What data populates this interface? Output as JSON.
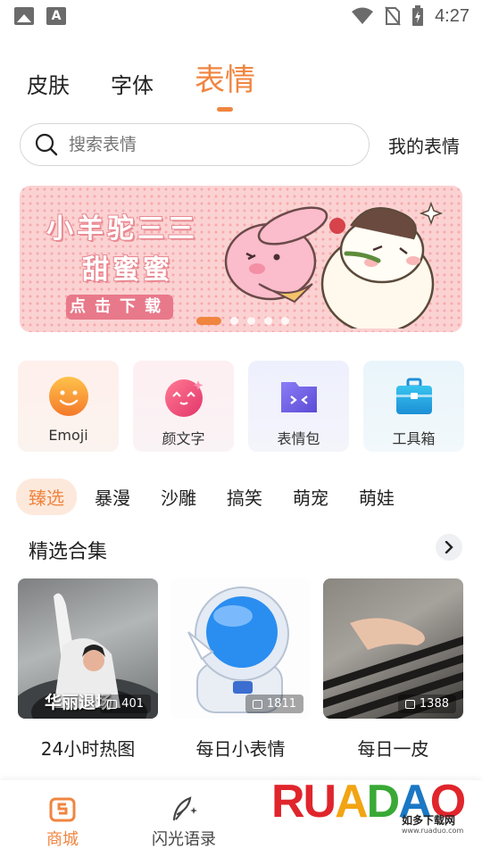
{
  "status_bar": {
    "time": "4:27"
  },
  "top_tabs": [
    {
      "label": "皮肤",
      "active": false
    },
    {
      "label": "字体",
      "active": false
    },
    {
      "label": "表情",
      "active": true
    }
  ],
  "search": {
    "placeholder": "搜索表情",
    "my_emoji_label": "我的表情"
  },
  "banner": {
    "title_line1": "小羊驼三三",
    "title_line2": "甜蜜蜜",
    "button_label": "点击下载",
    "slide_count": 5,
    "active_slide": 1
  },
  "categories": [
    {
      "label": "Emoji",
      "icon": "emoji-face-icon"
    },
    {
      "label": "颜文字",
      "icon": "kaomoji-icon"
    },
    {
      "label": "表情包",
      "icon": "sticker-folder-icon"
    },
    {
      "label": "工具箱",
      "icon": "toolbox-icon"
    }
  ],
  "sub_tabs": [
    {
      "label": "臻选",
      "active": true
    },
    {
      "label": "暴漫",
      "active": false
    },
    {
      "label": "沙雕",
      "active": false
    },
    {
      "label": "搞笑",
      "active": false
    },
    {
      "label": "萌宠",
      "active": false
    },
    {
      "label": "萌娃",
      "active": false
    }
  ],
  "section": {
    "title": "精选合集"
  },
  "collections": [
    {
      "label": "24小时热图",
      "count": "401",
      "overlay_text": "华丽退场"
    },
    {
      "label": "每日小表情",
      "count": "1811"
    },
    {
      "label": "每日一皮",
      "count": "1388"
    }
  ],
  "bottom_nav": [
    {
      "label": "商城",
      "active": true
    },
    {
      "label": "闪光语录",
      "active": false
    }
  ],
  "watermark": {
    "brand": "RUANDAO",
    "sub": "如多下载网",
    "url": "www.ruaduo.com"
  },
  "colors": {
    "accent": "#f08540",
    "banner_bg": "#fbd2d2"
  }
}
